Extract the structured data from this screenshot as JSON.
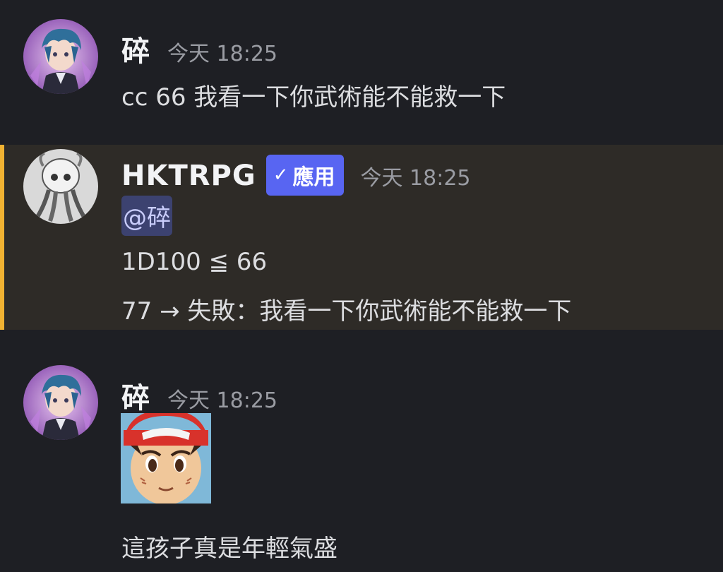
{
  "messages": [
    {
      "author": "碎",
      "timestamp": "今天 18:25",
      "text": "cc 66 我看一下你武術能不能救一下"
    },
    {
      "author": "HKTRPG",
      "badge": "應用",
      "badge_check": "✓",
      "timestamp": "今天 18:25",
      "mention": "@碎",
      "lines": [
        "1D100 ≦ 66",
        "77 → 失敗：我看一下你武術能不能救一下"
      ]
    },
    {
      "author": "碎",
      "timestamp": "今天 18:25",
      "text": "這孩子真是年輕氣盛"
    }
  ],
  "colors": {
    "background": "#1e1f24",
    "highlight_bg": "#2e2b27",
    "highlight_bar": "#f0b232",
    "badge": "#5865f2",
    "mention_bg": "#3c4270"
  },
  "icons": {
    "user_avatar": "anime-boy-avatar",
    "bot_avatar": "cthulhu-avatar",
    "sticker": "ash-ketchum-face-sticker"
  }
}
